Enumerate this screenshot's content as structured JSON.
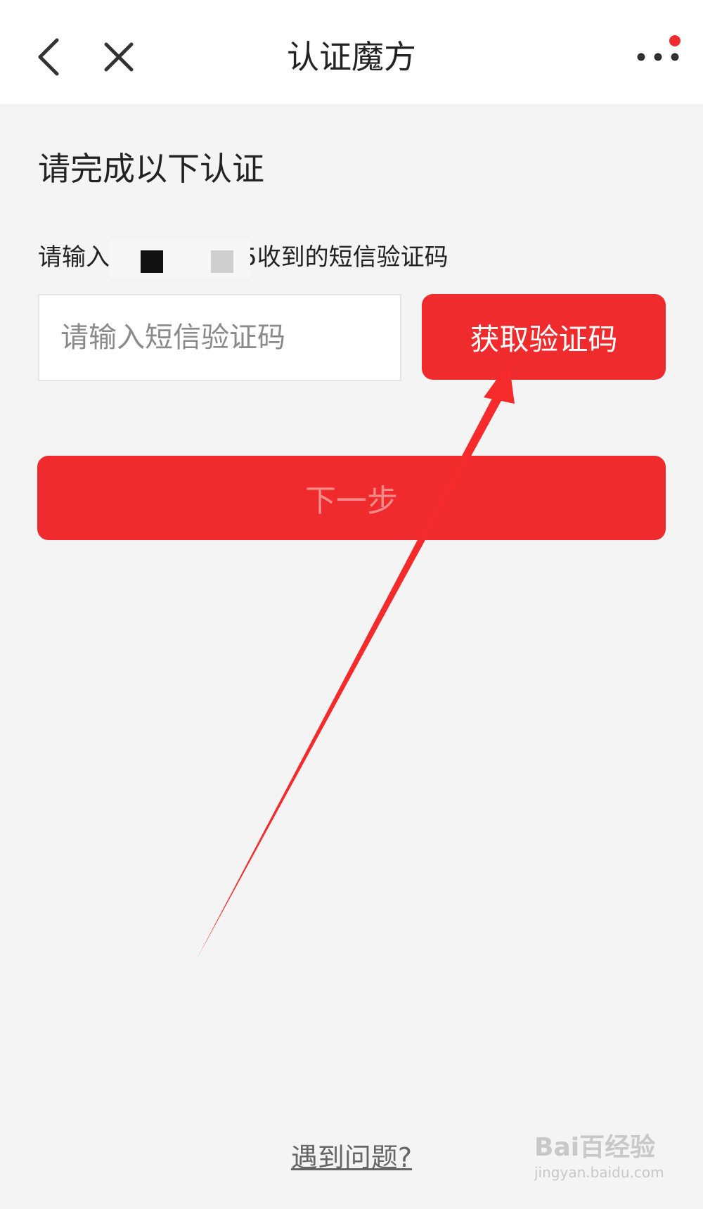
{
  "header": {
    "title": "认证魔方",
    "back_icon": "chevron-left-icon",
    "close_icon": "close-icon",
    "more_icon": "more-horizontal-icon",
    "notification_dot_color": "#f02b2e"
  },
  "main": {
    "heading": "请完成以下认证",
    "hint_prefix": "请输入",
    "hint_suffix": "5收到的短信验证码",
    "code_input": {
      "value": "",
      "placeholder": "请输入短信验证码"
    },
    "get_code_label": "获取验证码",
    "next_label": "下一步",
    "help_link": "遇到问题?"
  },
  "annotation": {
    "arrow_color": "#f52a2a"
  },
  "watermark": {
    "main": "Bai百经验",
    "sub": "jingyan.baidu.com"
  },
  "colors": {
    "accent": "#f02b2e",
    "background": "#f4f4f4",
    "topbar": "#ffffff"
  }
}
